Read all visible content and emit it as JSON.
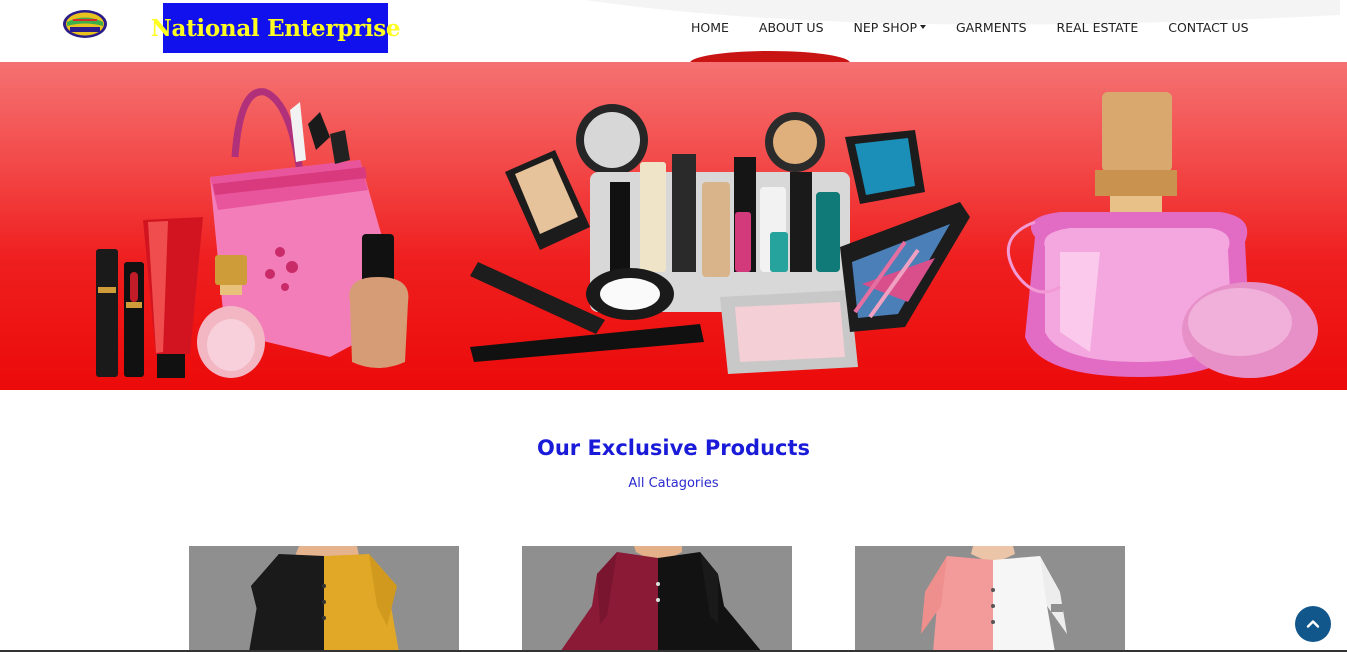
{
  "header": {
    "brand_name": "National Enterprise",
    "logo_icon": "national-enterprise-emblem-icon",
    "nav_items": [
      {
        "label": "HOME"
      },
      {
        "label": "ABOUT US"
      },
      {
        "label": "NEP SHOP",
        "has_dropdown": true
      },
      {
        "label": "GARMENTS"
      },
      {
        "label": "REAL ESTATE"
      },
      {
        "label": "CONTACT US"
      }
    ]
  },
  "hero": {
    "image": "cosmetics-banner",
    "background_color": "#ee1111"
  },
  "products": {
    "title": "Our Exclusive Products",
    "subtitle_link": "All Catagories",
    "cards": [
      {
        "image": "black-yellow-kurti-product-image"
      },
      {
        "image": "maroon-black-kurti-product-image"
      },
      {
        "image": "peach-white-kurti-product-image"
      }
    ]
  },
  "scroll_top": {
    "icon": "chevron-up-icon"
  },
  "colors": {
    "brand_box": "#1111ee",
    "brand_text": "#ffff22",
    "section_title": "#1a1ad9",
    "scroll_button": "#12578c"
  }
}
